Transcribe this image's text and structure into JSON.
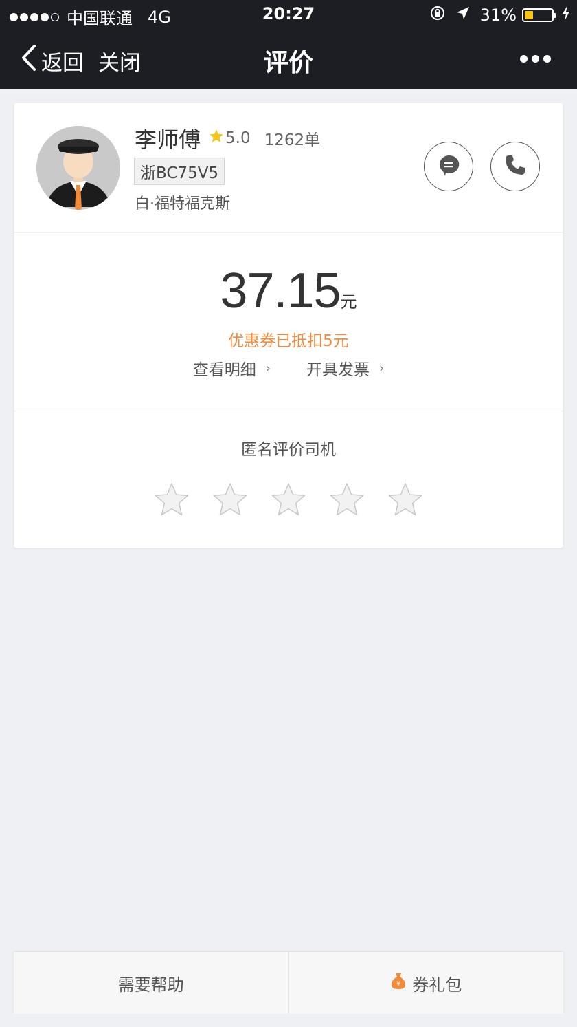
{
  "status_bar": {
    "carrier": "中国联通",
    "network": "4G",
    "time": "20:27",
    "battery": "31%",
    "battery_level": 0.31
  },
  "nav": {
    "back_label": "返回",
    "close_label": "关闭",
    "title": "评价"
  },
  "driver": {
    "name": "李师傅",
    "rating": "5.0",
    "orders": "1262单",
    "plate": "浙BC75V5",
    "car": "白·福特福克斯"
  },
  "fare": {
    "amount": "37.15",
    "unit": "元",
    "coupon_note": "优惠券已抵扣5元",
    "details_label": "查看明细",
    "invoice_label": "开具发票"
  },
  "review": {
    "prompt": "匿名评价司机",
    "stars_total": 5,
    "stars_selected": 0
  },
  "bottom": {
    "help_label": "需要帮助",
    "coupon_pack_label": "券礼包"
  },
  "colors": {
    "header_bg": "#1d1e24",
    "accent_orange": "#f08b3c",
    "rating_star": "#f5c518"
  }
}
